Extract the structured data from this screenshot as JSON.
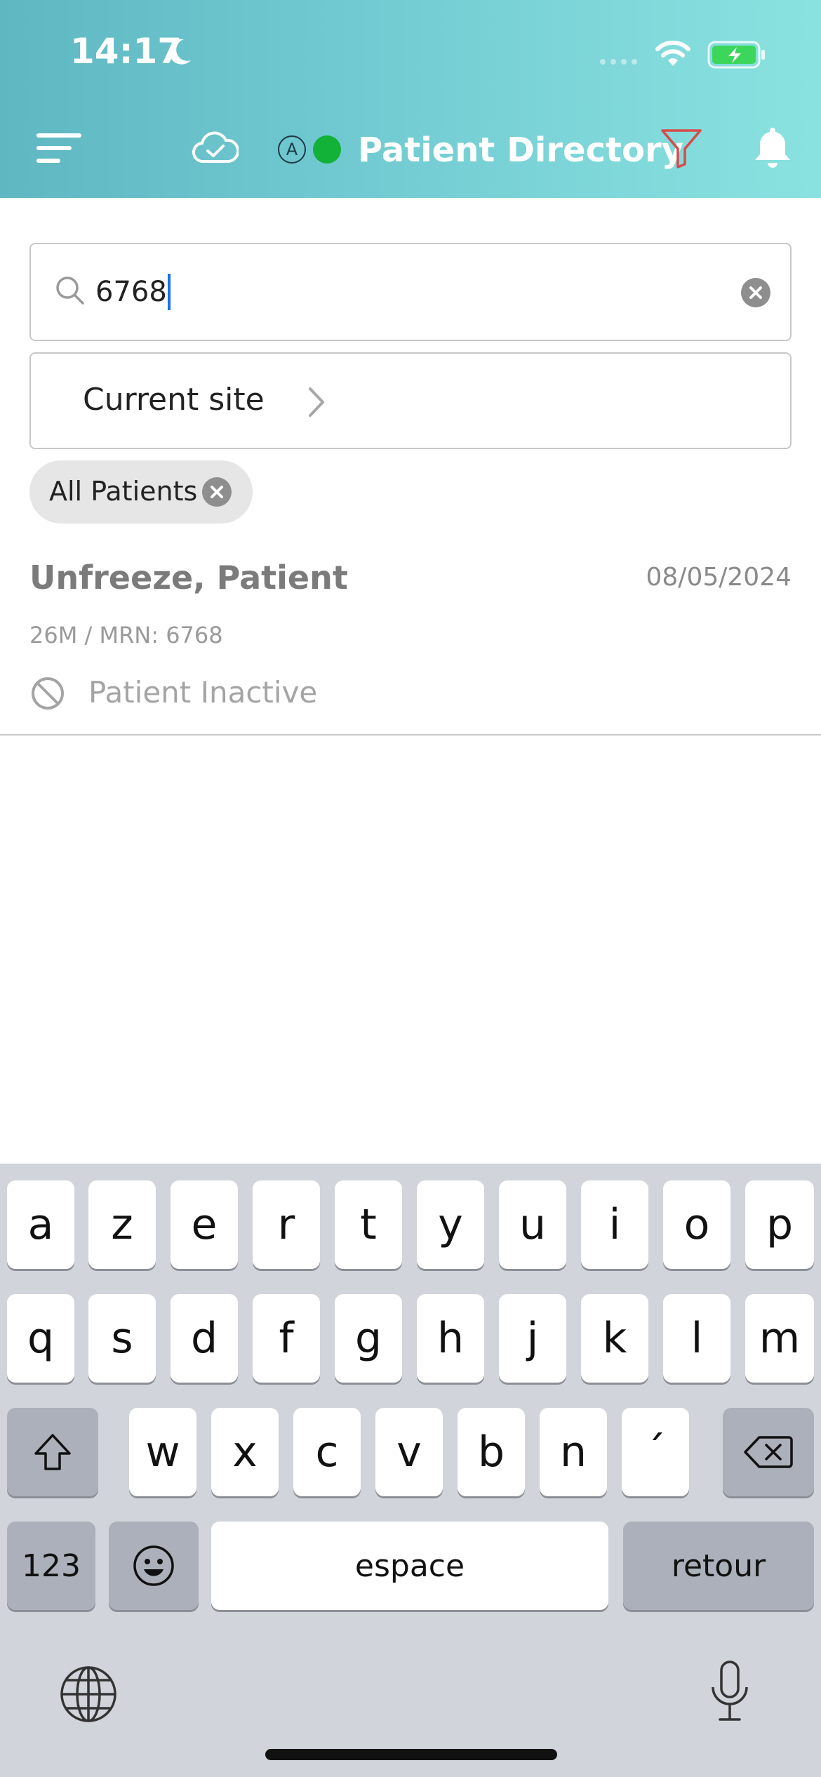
{
  "status_bar": {
    "time": "14:17"
  },
  "header": {
    "title": "Patient Directory",
    "account_badge": "A",
    "colors": {
      "online": "#12b138",
      "filter": "#d84a4a",
      "gradient_start": "#5fb7c2",
      "gradient_end": "#8ae2e0"
    },
    "icons": [
      "menu-icon",
      "cloud-check-icon",
      "filter-icon",
      "bell-icon"
    ]
  },
  "search": {
    "value": "6768"
  },
  "site_selector": {
    "label": "Current site"
  },
  "filter_chip": {
    "label": "All Patients"
  },
  "results": [
    {
      "name": "Unfreeze, Patient",
      "date": "08/05/2024",
      "meta": "26M / MRN: 6768",
      "status": "Patient Inactive"
    }
  ],
  "keyboard": {
    "row1": [
      "a",
      "z",
      "e",
      "r",
      "t",
      "y",
      "u",
      "i",
      "o",
      "p"
    ],
    "row2": [
      "q",
      "s",
      "d",
      "f",
      "g",
      "h",
      "j",
      "k",
      "l",
      "m"
    ],
    "row3": [
      "w",
      "x",
      "c",
      "v",
      "b",
      "n",
      "´"
    ],
    "numbers_key": "123",
    "space_key": "espace",
    "return_key": "retour"
  }
}
